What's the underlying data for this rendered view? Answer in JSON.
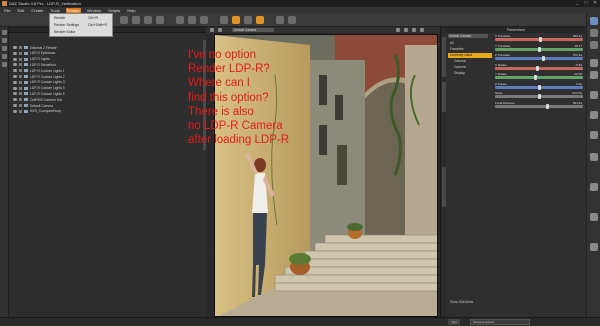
{
  "window": {
    "title": "DAZ Studio 4.8 Pro - LDP-R_Verification",
    "controls": [
      "_",
      "□",
      "✕"
    ]
  },
  "menu": {
    "items": [
      "File",
      "Edit",
      "Create",
      "Tools",
      "Render",
      "Window",
      "Scripts",
      "Help"
    ],
    "active": "Render"
  },
  "render_menu": {
    "items": [
      {
        "label": "Render",
        "shortcut": "Ctrl+R"
      },
      {
        "label": "Render Settings",
        "shortcut": "Ctrl+Shift+R"
      },
      {
        "label": "Render Editor",
        "shortcut": ""
      }
    ]
  },
  "scene": {
    "items": [
      "Genesis 2 Female",
      "LDP-R Eyebrows",
      "LDP-R Lights",
      "LDP-R Stonefloor",
      "LDP-R Custom Lights 1",
      "LDP-R Custom Lights 2",
      "LDP-R Custom Lights 3",
      "LDP-R Custom Lights 4",
      "LDP-R Custom Lights 5",
      "OutFit03 Summer Hat",
      "Default Camera",
      "NVS_CourtyardHoop"
    ]
  },
  "viewport": {
    "camera_label": "Default Camera"
  },
  "annotation": {
    "lines": [
      "I've no option",
      "Render LDP-R?",
      "Where can I",
      "find this option?",
      "There is also",
      "no LDP-R Camera",
      "after loading LDP-R"
    ]
  },
  "parameters": {
    "title": "Parameters",
    "selector": "Default Camera",
    "categories": [
      "All",
      "Favorites",
      "Currently Used",
      "General",
      "Camera",
      "Display"
    ],
    "selected_category": "Currently Used",
    "rows": [
      {
        "label": "X Translate",
        "value": "250.44",
        "color": "#c9675f",
        "fraction": 0.52
      },
      {
        "label": "Y Translate",
        "value": "15.77",
        "color": "#5fa46a",
        "fraction": 0.5
      },
      {
        "label": "Z Translate",
        "value": "672.34",
        "color": "#5e7bbd",
        "fraction": 0.55
      },
      {
        "label": "X Rotate",
        "value": "-5.84",
        "color": "#c9675f",
        "fraction": 0.48
      },
      {
        "label": "Y Rotate",
        "value": "-22.00",
        "color": "#5fa46a",
        "fraction": 0.46
      },
      {
        "label": "Z Rotate",
        "value": "0.00",
        "color": "#5e7bbd",
        "fraction": 0.5
      },
      {
        "label": "Scale",
        "value": "100.0%",
        "color": "#7a7a7a",
        "fraction": 0.5
      },
      {
        "label": "Focal Distance",
        "value": "694.64",
        "color": "#7a7a7a",
        "fraction": 0.6
      }
    ],
    "show_sub_items": "Show Sub Items"
  },
  "bottom": {
    "tips_label": "Tips",
    "selection_label": "Select a Lesson"
  },
  "colors": {
    "accent": "#e8a81e",
    "menu_highlight": "#e07a1a",
    "annotation": "#e41a1c"
  }
}
